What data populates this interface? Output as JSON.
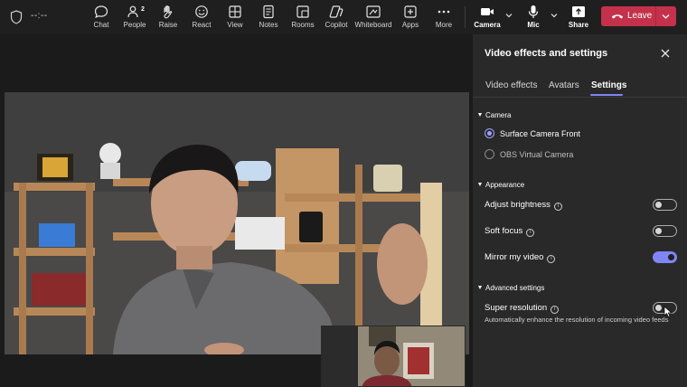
{
  "toolbar": {
    "timer": "--:--",
    "items": [
      {
        "label": "Chat",
        "icon": "chat-icon"
      },
      {
        "label": "People",
        "icon": "people-icon",
        "count": "2"
      },
      {
        "label": "Raise",
        "icon": "raise-hand-icon"
      },
      {
        "label": "React",
        "icon": "react-icon"
      },
      {
        "label": "View",
        "icon": "view-icon"
      },
      {
        "label": "Notes",
        "icon": "notes-icon"
      },
      {
        "label": "Rooms",
        "icon": "rooms-icon"
      },
      {
        "label": "Copilot",
        "icon": "copilot-icon"
      },
      {
        "label": "Whiteboard",
        "icon": "whiteboard-icon"
      },
      {
        "label": "Apps",
        "icon": "apps-icon"
      },
      {
        "label": "More",
        "icon": "more-icon"
      }
    ],
    "camera_label": "Camera",
    "mic_label": "Mic",
    "share_label": "Share",
    "leave_label": "Leave",
    "leave_color": "#c4314b",
    "accent_color": "#7f85f5"
  },
  "panel": {
    "title": "Video effects and settings",
    "tabs": [
      {
        "label": "Video effects",
        "active": false
      },
      {
        "label": "Avatars",
        "active": false
      },
      {
        "label": "Settings",
        "active": true
      }
    ],
    "camera": {
      "section_label": "Camera",
      "options": [
        {
          "label": "Surface Camera Front",
          "selected": true
        },
        {
          "label": "OBS Virtual Camera",
          "selected": false
        }
      ]
    },
    "appearance": {
      "section_label": "Appearance",
      "rows": [
        {
          "label": "Adjust brightness",
          "on": false
        },
        {
          "label": "Soft focus",
          "on": false
        },
        {
          "label": "Mirror my video",
          "on": true
        }
      ]
    },
    "advanced": {
      "section_label": "Advanced settings",
      "super_resolution_label": "Super resolution",
      "super_resolution_on": false,
      "super_resolution_desc": "Automatically enhance the resolution of incoming video feeds"
    }
  }
}
